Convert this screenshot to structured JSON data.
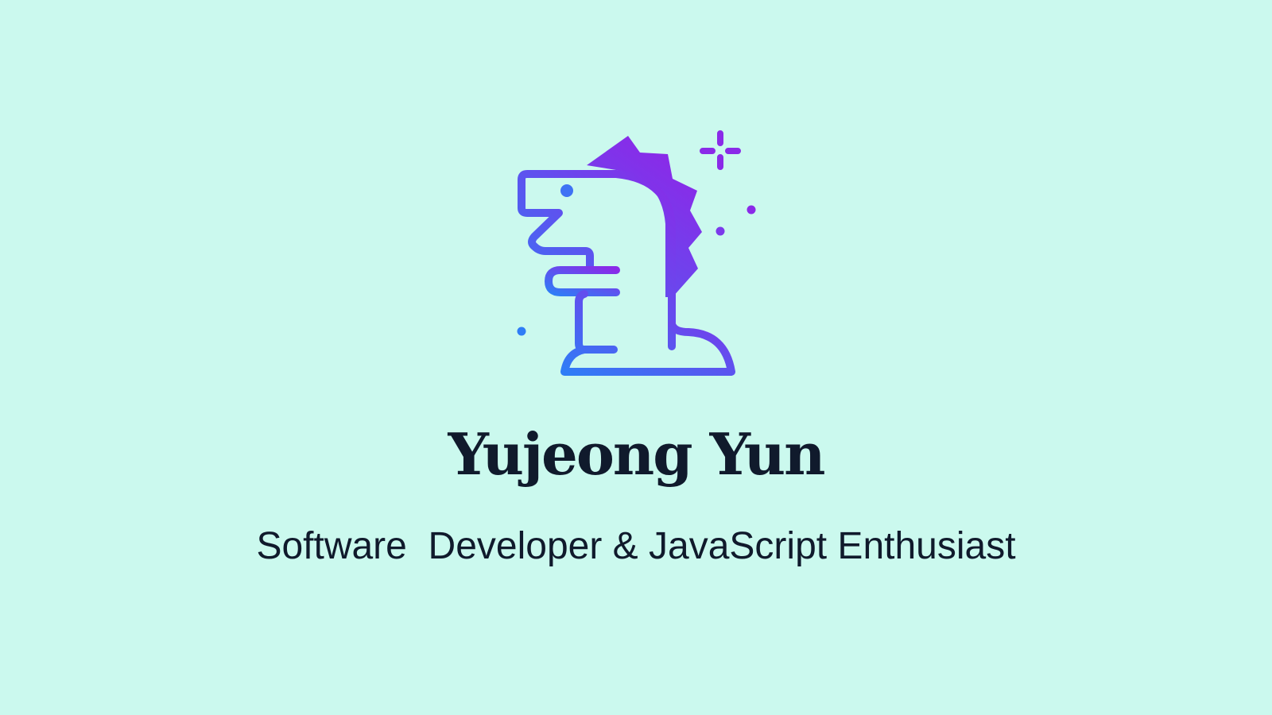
{
  "profile": {
    "name": "Yujeong Yun",
    "tagline": "Software  Developer & JavaScript Enthusiast"
  },
  "logo": {
    "icon": "dinosaur-mascot-icon",
    "gradient_start": "#2f7df6",
    "gradient_end": "#8a2ae8"
  },
  "colors": {
    "background": "#cbf9ee",
    "text": "#101a2c"
  }
}
